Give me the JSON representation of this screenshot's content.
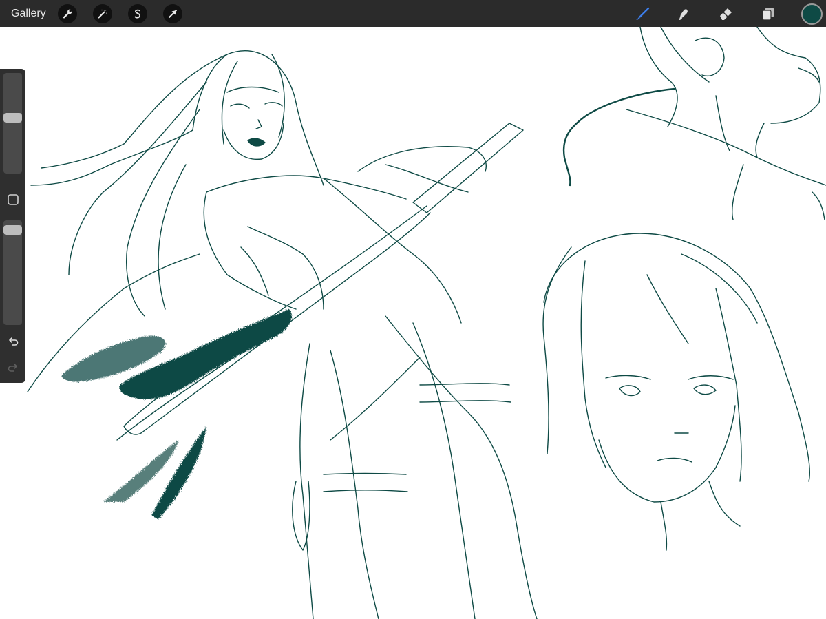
{
  "topbar": {
    "gallery_label": "Gallery",
    "left_tools": [
      {
        "name": "wrench-icon"
      },
      {
        "name": "magic-wand-icon"
      },
      {
        "name": "selection-icon"
      },
      {
        "name": "transform-arrow-icon"
      }
    ],
    "right_tools": [
      {
        "name": "brush-icon",
        "active": true
      },
      {
        "name": "smudge-icon",
        "active": false
      },
      {
        "name": "eraser-icon",
        "active": false
      },
      {
        "name": "layers-icon",
        "active": false
      }
    ],
    "current_color": "#0e4a45"
  },
  "sidebar": {
    "brush_size": 0.56,
    "brush_opacity": 0.95,
    "modify_button": {
      "name": "modify-square-icon"
    },
    "undo": {
      "name": "undo-icon",
      "enabled": true
    },
    "redo": {
      "name": "redo-icon",
      "enabled": false
    }
  },
  "theme": {
    "ink_color": "#0e4a45",
    "toolbar_bg": "#2b2b2b",
    "active_tool_color": "#3d7eea"
  }
}
